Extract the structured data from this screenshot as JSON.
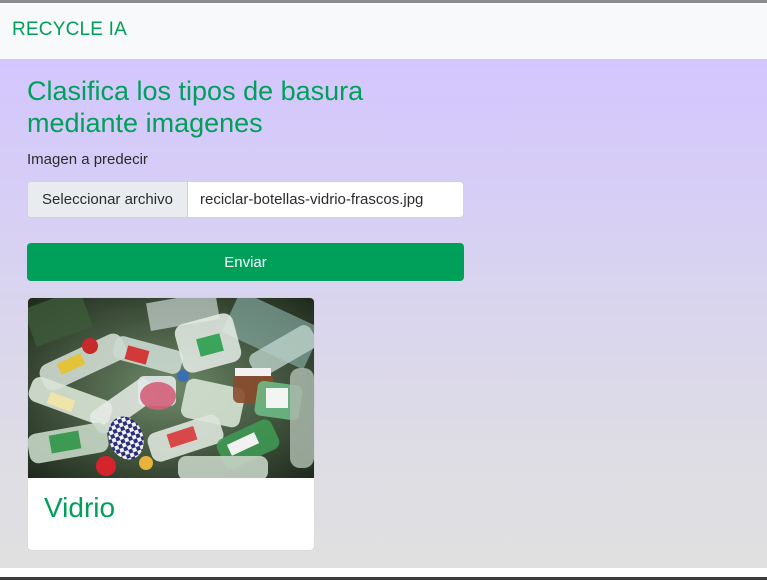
{
  "navbar": {
    "brand": "RECYCLE IA"
  },
  "main": {
    "title": "Clasifica los tipos de basura mediante imagenes",
    "form": {
      "label": "Imagen a predecir",
      "file_button_label": "Seleccionar archivo",
      "file_name": "reciclar-botellas-vidrio-frascos.jpg",
      "submit_label": "Enviar"
    },
    "result": {
      "image_alt": "reciclar-botellas-vidrio-frascos.jpg",
      "label": "Vidrio"
    }
  },
  "colors": {
    "brand_green": "#00a05a",
    "navbar_bg": "#f8f9fa",
    "gradient_top": "#d3c6fe",
    "gradient_bottom": "#e0e0e0"
  }
}
